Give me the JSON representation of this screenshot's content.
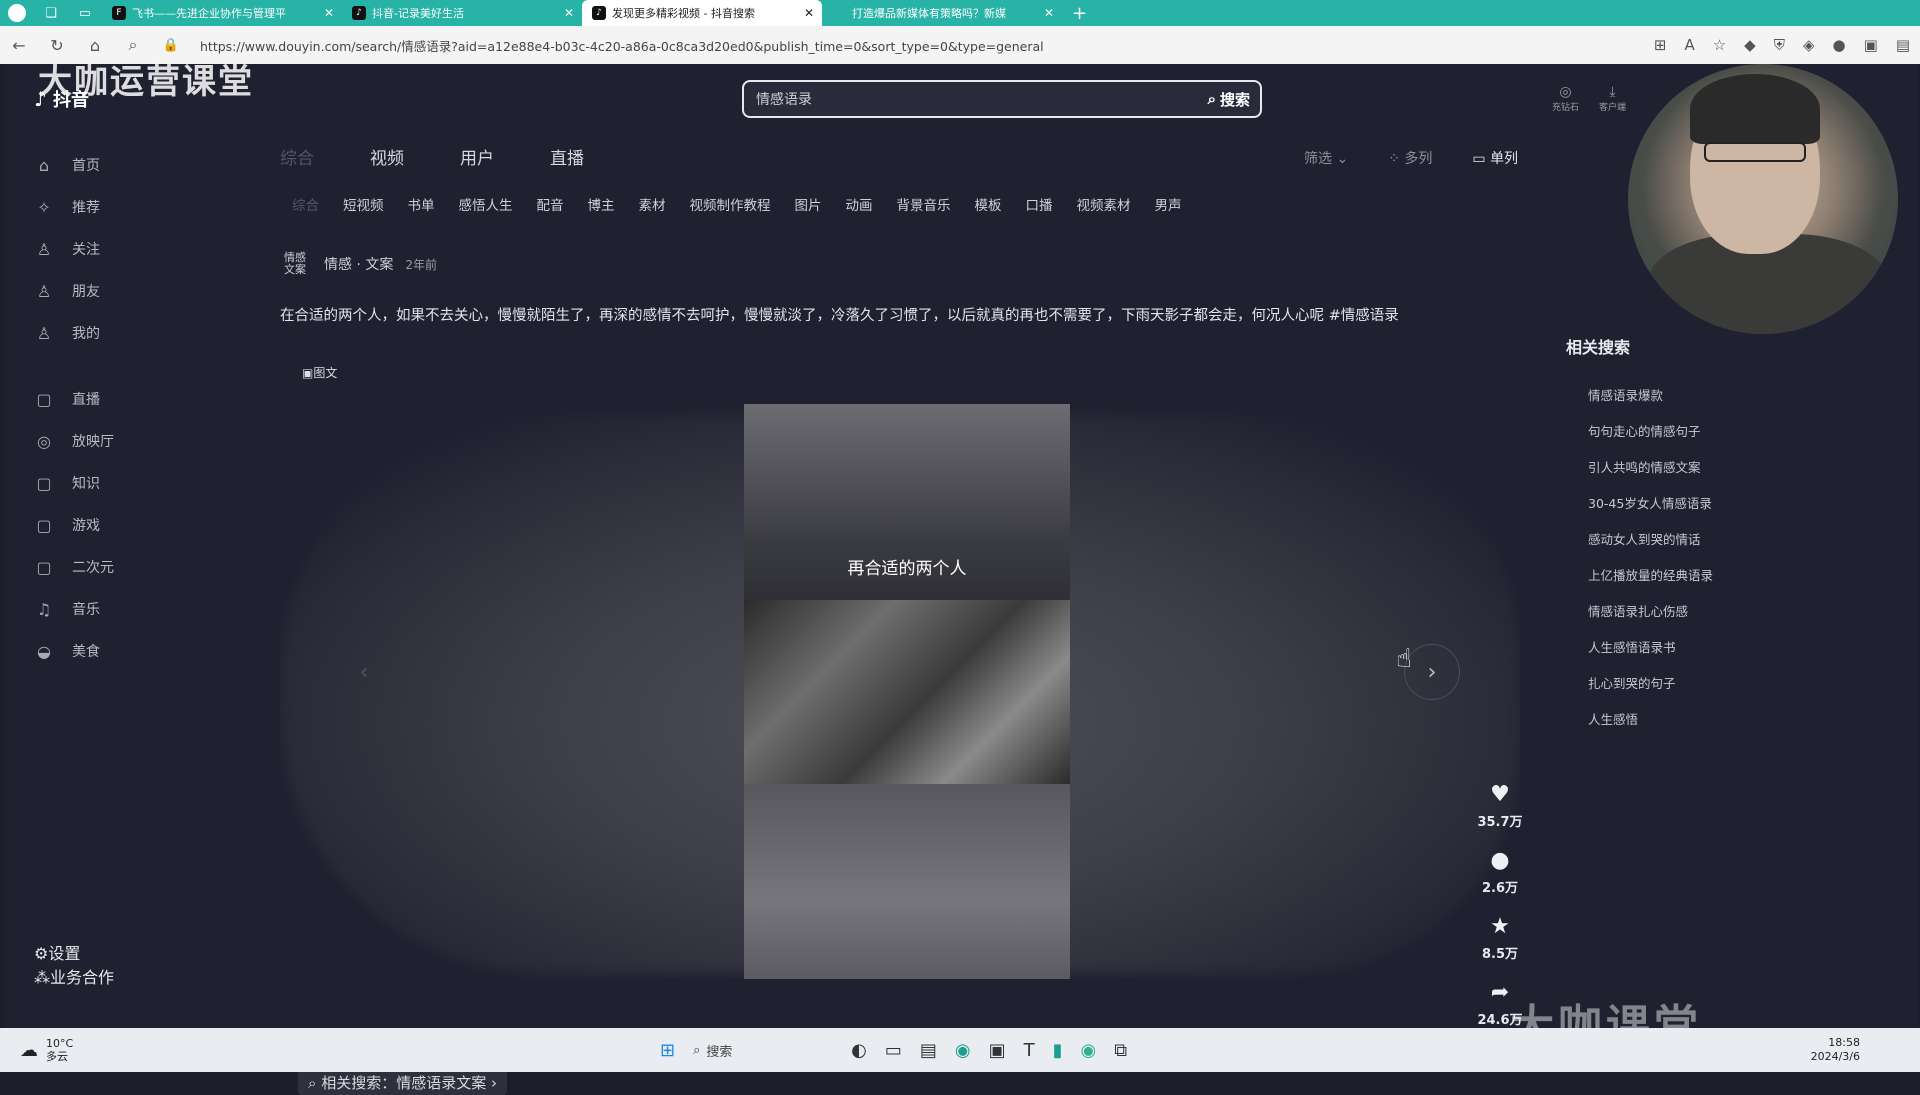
{
  "browser": {
    "tabs": [
      {
        "label": "飞书——先进企业协作与管理平",
        "active": false
      },
      {
        "label": "抖音-记录美好生活",
        "active": false
      },
      {
        "label": "发现更多精彩视频 - 抖音搜索",
        "active": true
      },
      {
        "label": "打造爆品新媒体有策略吗？新媒",
        "active": false
      }
    ],
    "new_tab": "+",
    "url": "https://www.douyin.com/search/情感语录?aid=a12e88e4-b03c-4c20-a86a-0c8ca3d20ed0&publish_time=0&sort_type=0&type=general"
  },
  "logo": {
    "text": "抖音",
    "watermark": "大咖运营课堂"
  },
  "search": {
    "value": "情感语录",
    "button": "搜索"
  },
  "sidebar": {
    "items": [
      {
        "label": "首页",
        "icon": "home-icon",
        "glyph": "⌂"
      },
      {
        "label": "推荐",
        "icon": "recommend-icon",
        "glyph": "✧"
      },
      {
        "label": "关注",
        "icon": "follow-icon",
        "glyph": "♙"
      },
      {
        "label": "朋友",
        "icon": "friends-icon",
        "glyph": "♙"
      },
      {
        "label": "我的",
        "icon": "me-icon",
        "glyph": "♙"
      }
    ],
    "items2": [
      {
        "label": "直播",
        "icon": "live-icon",
        "glyph": "▢"
      },
      {
        "label": "放映厅",
        "icon": "cinema-icon",
        "glyph": "◎"
      },
      {
        "label": "知识",
        "icon": "knowledge-icon",
        "glyph": "▢"
      },
      {
        "label": "游戏",
        "icon": "game-icon",
        "glyph": "▢"
      },
      {
        "label": "二次元",
        "icon": "anime-icon",
        "glyph": "▢"
      },
      {
        "label": "音乐",
        "icon": "music-icon",
        "glyph": "♫"
      },
      {
        "label": "美食",
        "icon": "food-icon",
        "glyph": "◒"
      }
    ],
    "bottom": [
      {
        "label": "设置",
        "icon": "settings-icon",
        "glyph": "⚙"
      },
      {
        "label": "业务合作",
        "icon": "business-icon",
        "glyph": "⁂"
      }
    ]
  },
  "main_tabs": {
    "t0": "综合",
    "t1": "视频",
    "t2": "用户",
    "t3": "直播"
  },
  "filters": {
    "filter": "筛选",
    "multi": "多列",
    "single": "单列"
  },
  "subtabs": [
    "综合",
    "短视频",
    "书单",
    "感悟人生",
    "配音",
    "博主",
    "素材",
    "视频制作教程",
    "图片",
    "动画",
    "背景音乐",
    "模板",
    "口播",
    "视频素材",
    "男声"
  ],
  "post": {
    "badge": "情感\n文案",
    "author_tags": "情感 · 文案",
    "time": "2年前",
    "description": "在合适的两个人，如果不去关心，慢慢就陌生了，再深的感情不去呵护，慢慢就淡了，冷落久了习惯了，以后就真的再也不需要了，下雨天影子都会走，何况人心呢 #情感语录",
    "type_tag": "图文",
    "caption": "再合适的两个人"
  },
  "actions": {
    "likes": "35.7万",
    "comments": "2.6万",
    "favorites": "8.5万",
    "shares": "24.6万"
  },
  "related_bar": "相关搜索：情感语录文案",
  "related": {
    "title": "相关搜索",
    "items": [
      "情感语录爆款",
      "句句走心的情感句子",
      "引人共鸣的情感文案",
      "30-45岁女人情感语录",
      "感动女人到哭的情话",
      "上亿播放量的经典语录",
      "情感语录扎心伤感",
      "人生感悟语录书",
      "扎心到哭的句子",
      "人生感悟"
    ]
  },
  "top_right": {
    "i1": "充钻石",
    "i2": "客户端"
  },
  "watermark_bottom": "大咖课堂",
  "taskbar": {
    "temp": "10°C",
    "weather": "多云",
    "search": "搜索",
    "time": "18:58",
    "date": "2024/3/6"
  }
}
